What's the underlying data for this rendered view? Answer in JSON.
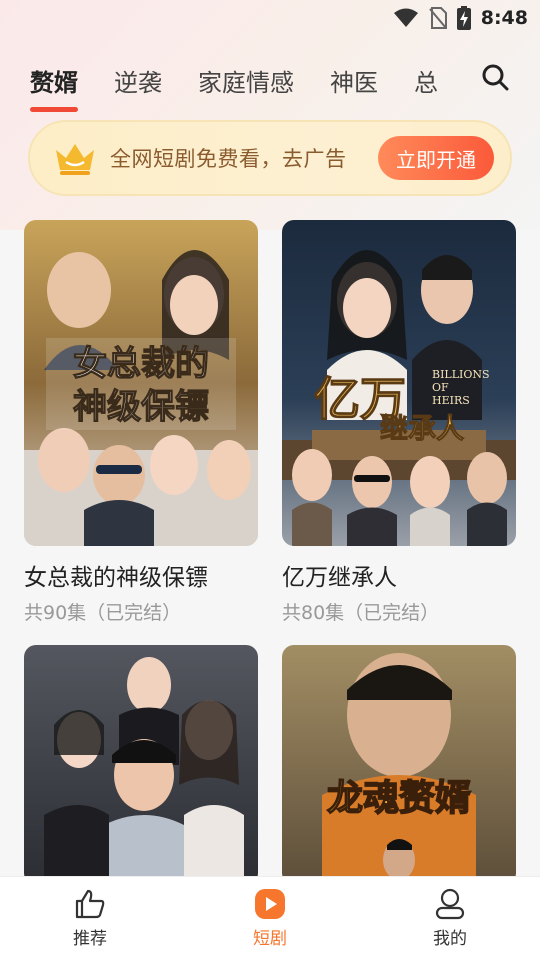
{
  "status_bar": {
    "time": "8:48"
  },
  "tabs": [
    {
      "label": "赘婿",
      "active": true
    },
    {
      "label": "逆袭",
      "active": false
    },
    {
      "label": "家庭情感",
      "active": false
    },
    {
      "label": "神医",
      "active": false
    },
    {
      "label": "总",
      "active": false
    }
  ],
  "banner": {
    "text": "全网短剧免费看，去广告",
    "button": "立即开通"
  },
  "dramas": [
    {
      "title": "女总裁的神级保镖",
      "subtitle": "共90集（已完结）",
      "poster_text": "女总裁的\n神级保镖"
    },
    {
      "title": "亿万继承人",
      "subtitle": "共80集（已完结）",
      "poster_text": "亿万继承人",
      "poster_en": "BILLIONS OF HEIRS"
    },
    {
      "title": "",
      "subtitle": "",
      "poster_text": ""
    },
    {
      "title": "",
      "subtitle": "",
      "poster_text": "龙魂赘婿"
    }
  ],
  "poster_lines": {
    "p1_l1": "女总裁的",
    "p1_l2": "神级保镖",
    "p2_main": "亿万",
    "p2_sub": "继承人",
    "p2_en1": "BILLIONS",
    "p2_en2": "OF",
    "p2_en3": "HEIRS",
    "p4_main": "龙魂赘婿"
  },
  "bottom_nav": [
    {
      "label": "推荐",
      "icon": "thumbs-up-icon",
      "active": false
    },
    {
      "label": "短剧",
      "icon": "play-icon",
      "active": true
    },
    {
      "label": "我的",
      "icon": "user-icon",
      "active": false
    }
  ],
  "colors": {
    "accent": "#f04a36",
    "nav_active": "#f6762d",
    "banner_text": "#8a5b2f"
  }
}
